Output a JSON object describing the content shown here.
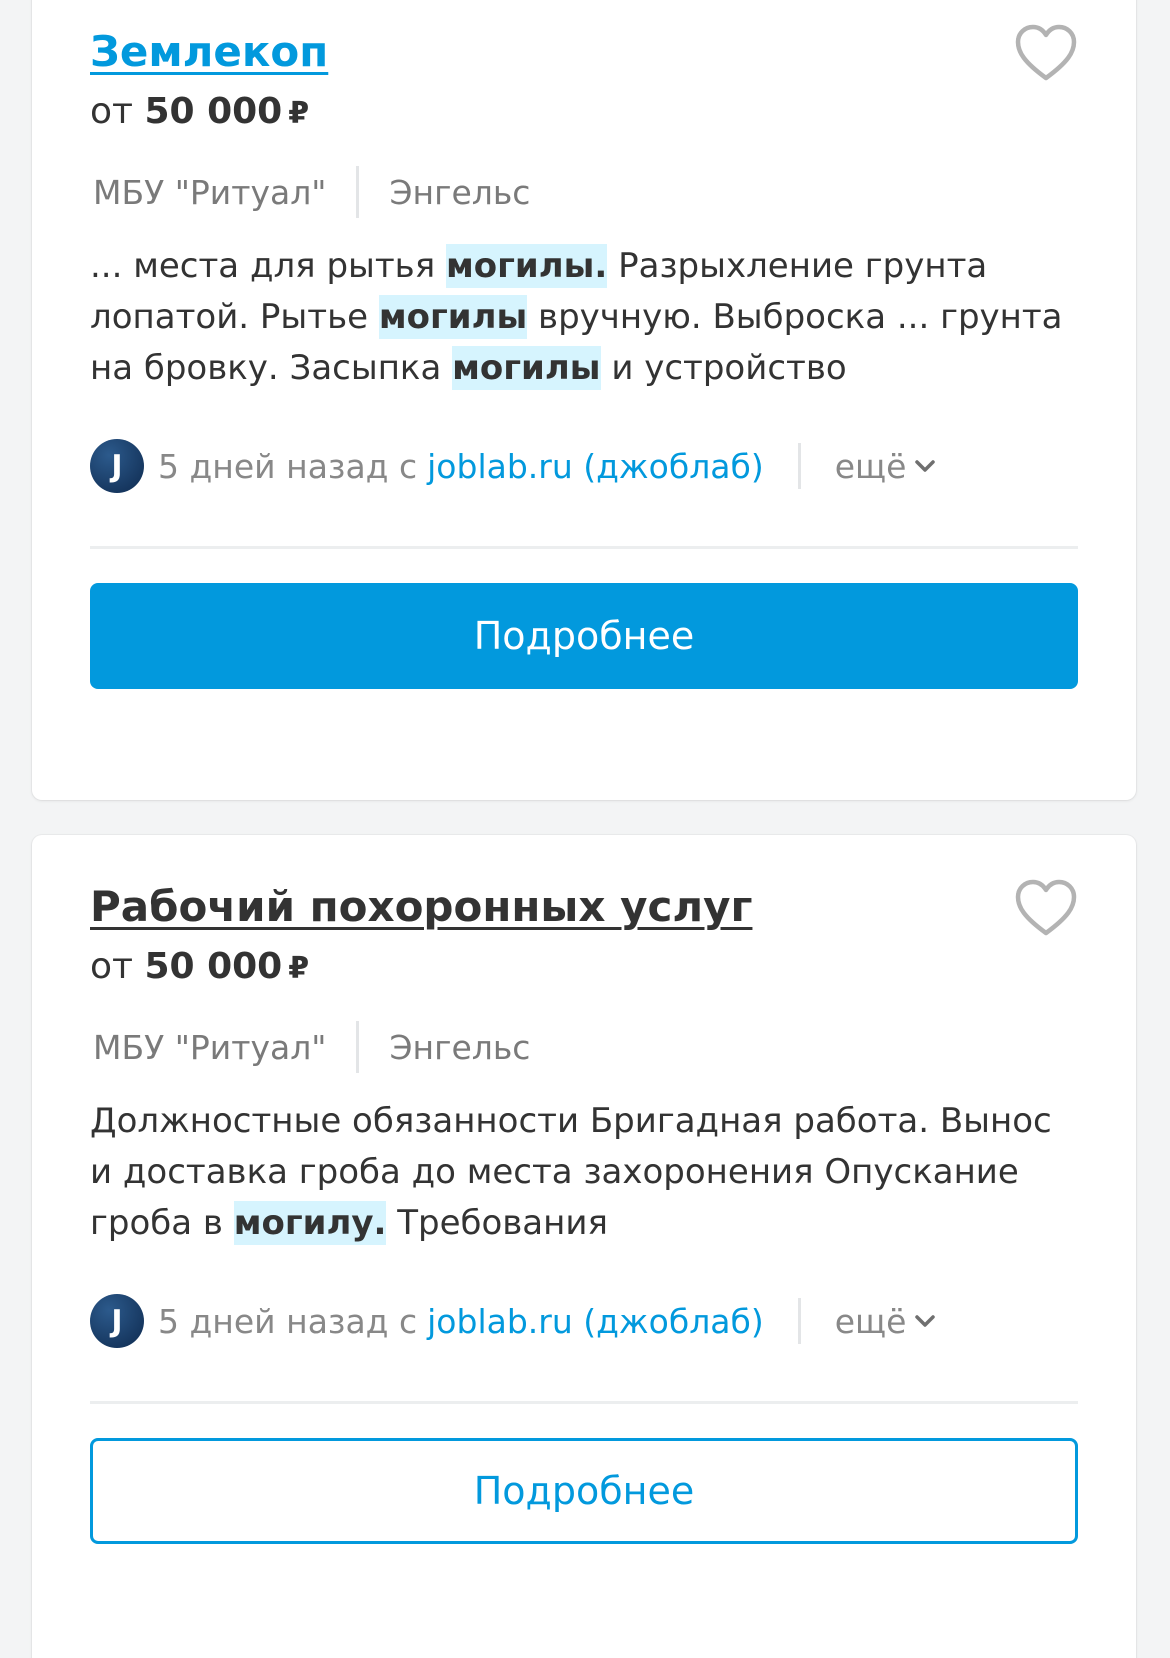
{
  "colors": {
    "accent": "#0299dd",
    "highlight_bg": "#d6f4fe",
    "text": "#333333",
    "muted": "#888888"
  },
  "vacancies": [
    {
      "title": "Землекоп",
      "title_visited": true,
      "salary_prefix": "от",
      "salary_amount": "50 000",
      "salary_currency": "₽",
      "company": "МБУ \"Ритуал\"",
      "city": "Энгельс",
      "snippet": [
        {
          "text": "... места для рытья ",
          "hl": false
        },
        {
          "text": "могилы.",
          "hl": true
        },
        {
          "text": " Разрыхление грунта лопатой. Рытье ",
          "hl": false
        },
        {
          "text": "могилы",
          "hl": true
        },
        {
          "text": " вручную. Выброска ... грунта на бровку. Засыпка ",
          "hl": false
        },
        {
          "text": "могилы",
          "hl": true
        },
        {
          "text": " и устройство",
          "hl": false
        }
      ],
      "source_avatar_letter": "J",
      "posted_ago": "5 дней назад с",
      "source_name": "joblab.ru (джоблаб)",
      "more_label": "ещё",
      "details_label": "Подробнее",
      "details_style": "solid",
      "favorite_icon": "heart-outline-icon"
    },
    {
      "title": "Рабочий похоронных услуг",
      "title_visited": false,
      "salary_prefix": "от",
      "salary_amount": "50 000",
      "salary_currency": "₽",
      "company": "МБУ \"Ритуал\"",
      "city": "Энгельс",
      "snippet": [
        {
          "text": "Должностные обязанности Бригадная работа. Вынос и доставка гроба до места захоронения Опускание гроба в ",
          "hl": false
        },
        {
          "text": "могилу.",
          "hl": true
        },
        {
          "text": " Требования",
          "hl": false
        }
      ],
      "source_avatar_letter": "J",
      "posted_ago": "5 дней назад с",
      "source_name": "joblab.ru (джоблаб)",
      "more_label": "ещё",
      "details_label": "Подробнее",
      "details_style": "outline",
      "favorite_icon": "heart-outline-icon"
    }
  ]
}
